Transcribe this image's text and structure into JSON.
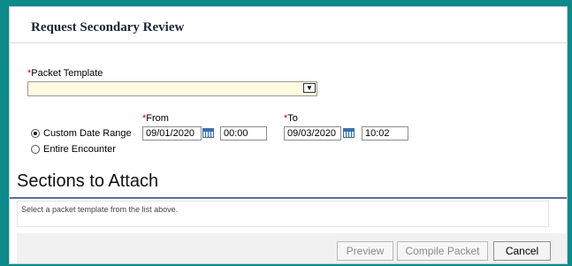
{
  "dialog": {
    "title": "Request Secondary Review",
    "packet_template": {
      "required_mark": "*",
      "label": "Packet Template",
      "value": "",
      "dropdown_arrow": "▼"
    },
    "date_options": [
      {
        "label": "Custom Date Range",
        "selected": true
      },
      {
        "label": "Entire Encounter",
        "selected": false
      }
    ],
    "from": {
      "required_mark": "*",
      "label": "From",
      "date": "09/01/2020",
      "time": "00:00"
    },
    "to": {
      "required_mark": "*",
      "label": "To",
      "date": "09/03/2020",
      "time": "10:02"
    },
    "sections": {
      "title": "Sections to Attach",
      "message": "Select a packet template from the list above."
    },
    "buttons": {
      "preview": "Preview",
      "compile": "Compile Packet",
      "cancel": "Cancel"
    }
  },
  "colors": {
    "background": "#0d8a8a",
    "required": "#d40000",
    "select_bg": "#fffbe0",
    "section_rule": "#5a6f9a"
  },
  "icons": {
    "calendar": "calendar-icon",
    "dropdown": "chevron-down-icon",
    "radio": "radio-button"
  }
}
